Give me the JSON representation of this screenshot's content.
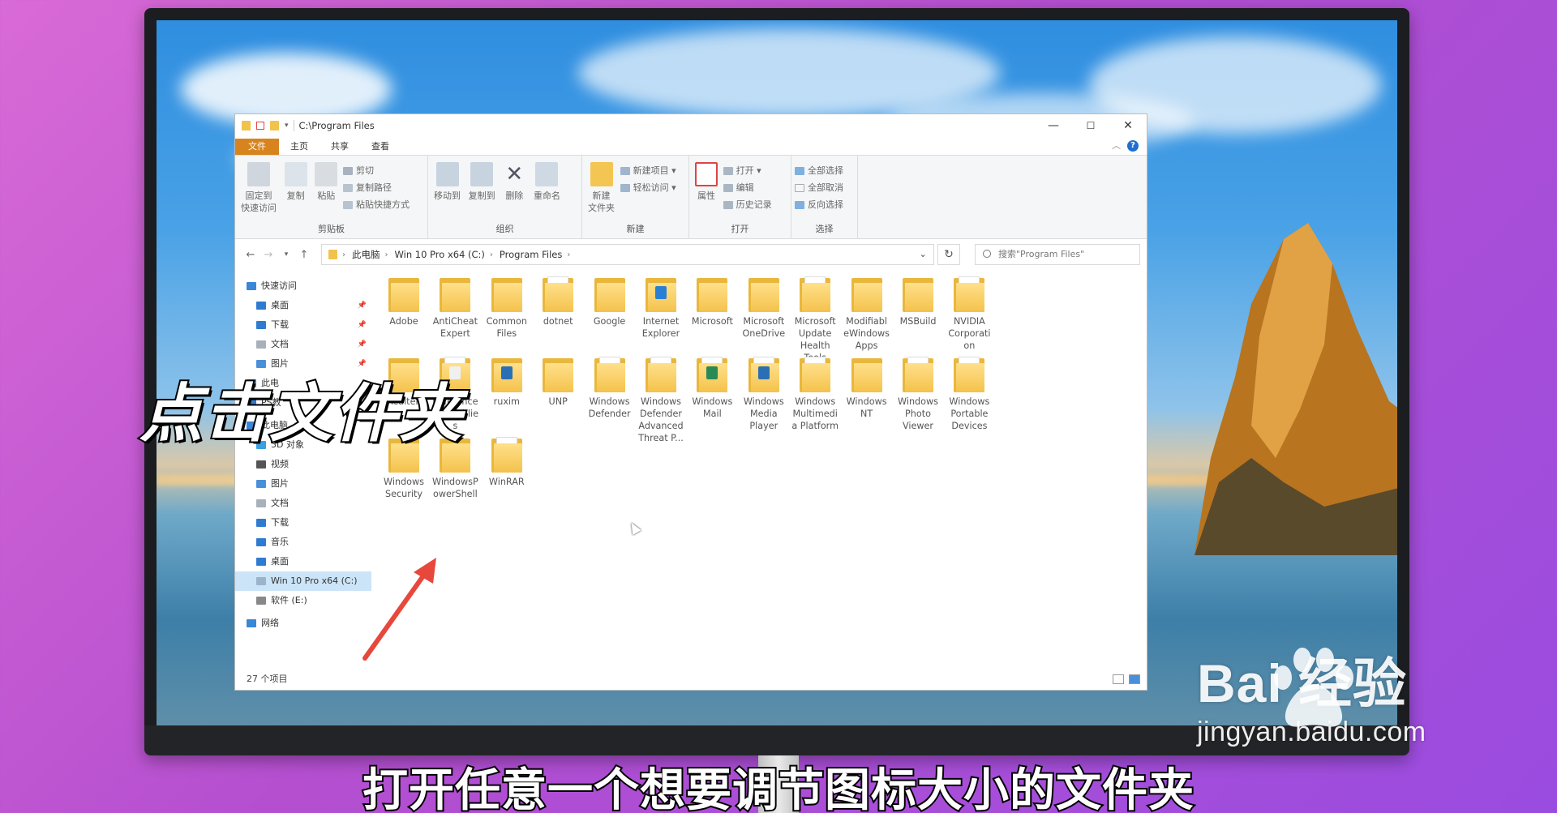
{
  "window": {
    "title": "C:\\Program Files",
    "controls": {
      "minimize": "—",
      "maximize": "☐",
      "close": "✕"
    }
  },
  "ribbon": {
    "tabs": [
      "文件",
      "主页",
      "共享",
      "查看"
    ],
    "clipboard": {
      "label": "剪贴板",
      "pin": "固定到\n快速访问",
      "copy": "复制",
      "paste": "粘贴",
      "cut": "剪切",
      "copy_path": "复制路径",
      "paste_shortcut": "粘贴快捷方式"
    },
    "organize": {
      "label": "组织",
      "move_to": "移动到",
      "copy_to": "复制到",
      "delete": "删除",
      "rename": "重命名"
    },
    "new": {
      "label": "新建",
      "new_folder": "新建\n文件夹",
      "new_item": "新建项目",
      "easy_access": "轻松访问"
    },
    "open": {
      "label": "打开",
      "properties": "属性",
      "open": "打开",
      "edit": "编辑",
      "history": "历史记录"
    },
    "select": {
      "label": "选择",
      "select_all": "全部选择",
      "select_none": "全部取消",
      "invert": "反向选择"
    }
  },
  "address": {
    "crumbs": [
      "此电脑",
      "Win 10 Pro x64 (C:)",
      "Program Files"
    ],
    "search_placeholder": "搜索\"Program Files\""
  },
  "nav": [
    {
      "label": "快速访问",
      "pinned": false
    },
    {
      "label": "桌面",
      "pinned": true
    },
    {
      "label": "下载",
      "pinned": true
    },
    {
      "label": "文档",
      "pinned": true
    },
    {
      "label": "图片",
      "pinned": true
    },
    {
      "label": "此电",
      "pinned": false
    },
    {
      "label": "PS教",
      "pinned": false
    },
    {
      "label": "此电脑",
      "pinned": false
    },
    {
      "label": "3D 对象",
      "pinned": false
    },
    {
      "label": "视频",
      "pinned": false
    },
    {
      "label": "图片",
      "pinned": false
    },
    {
      "label": "文档",
      "pinned": false
    },
    {
      "label": "下载",
      "pinned": false
    },
    {
      "label": "音乐",
      "pinned": false
    },
    {
      "label": "桌面",
      "pinned": false
    },
    {
      "label": "Win 10 Pro x64 (C:)",
      "pinned": false
    },
    {
      "label": "软件 (E:)",
      "pinned": false
    },
    {
      "label": "网络",
      "pinned": false
    }
  ],
  "folders": [
    [
      "Adobe",
      "AntiCheat Expert",
      "Common Files",
      "dotnet",
      "Google",
      "Internet Explorer",
      "Microsoft",
      "Microsoft OneDrive",
      "Microsoft Update Health Tools",
      "Modifiabl eWindows Apps",
      "MSBuild",
      "NVIDIA Corporati on"
    ],
    [
      "Realtek",
      "Reference Assemblie s",
      "ruxim",
      "UNP",
      "Windows Defender",
      "Windows Defender Advanced Threat P...",
      "Windows Mail",
      "Windows Media Player",
      "Windows Multimedi a Platform",
      "Windows NT",
      "Windows Photo Viewer",
      "Windows Portable Devices"
    ],
    [
      "Windows Security",
      "WindowsP owerShell",
      "WinRAR"
    ]
  ],
  "status": {
    "count": "27 个项目"
  },
  "overlay": {
    "title": "点击文件夹",
    "subtitle": "打开任意一个想要调节图标大小的文件夹"
  },
  "watermark": {
    "logo": "Bai  经验",
    "url": "jingyan.baidu.com"
  },
  "colors": {
    "accent": "#d8841e",
    "selection": "#cce4f7",
    "arrow": "#e8473c"
  }
}
